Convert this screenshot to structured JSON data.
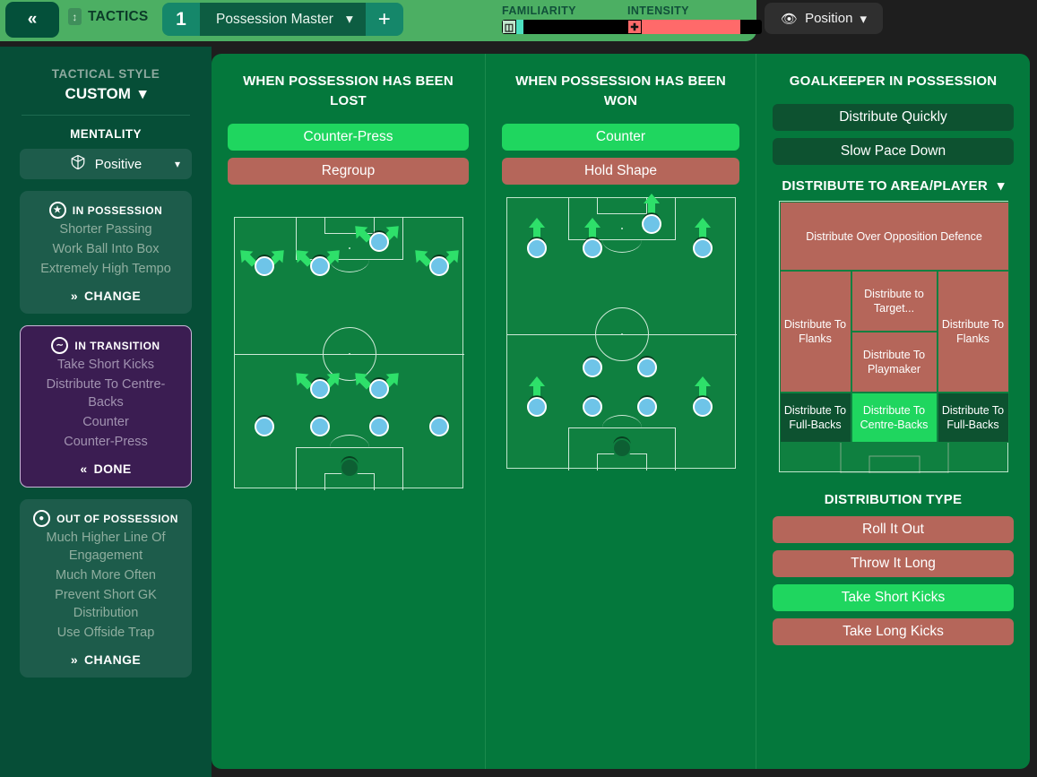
{
  "topbar": {
    "collapse_icon": "double-chevron-left",
    "tactics_label": "TACTICS",
    "tab_number": "1",
    "tab_name": "Possession Master",
    "add_label": "+",
    "familiarity_label": "FAMILIARITY",
    "intensity_label": "INTENSITY",
    "familiarity_value": 6,
    "intensity_value": 82,
    "position_button": "Position"
  },
  "sidebar": {
    "tactical_style_label": "TACTICAL STYLE",
    "tactical_style_value": "CUSTOM",
    "mentality_label": "MENTALITY",
    "mentality_value": "Positive",
    "phases": [
      {
        "title": "IN POSSESSION",
        "items": [
          "Shorter Passing",
          "Work Ball Into Box",
          "Extremely High Tempo"
        ],
        "action": "CHANGE",
        "action_icon": "double-chevron-right",
        "active": false
      },
      {
        "title": "IN TRANSITION",
        "items": [
          "Take Short Kicks",
          "Distribute To Centre-Backs",
          "Counter",
          "Counter-Press"
        ],
        "action": "DONE",
        "action_icon": "double-chevron-left",
        "active": true
      },
      {
        "title": "OUT OF POSSESSION",
        "items": [
          "Much Higher Line Of Engagement",
          "Much More Often",
          "Prevent Short GK Distribution",
          "Use Offside Trap"
        ],
        "action": "CHANGE",
        "action_icon": "double-chevron-right",
        "active": false
      }
    ]
  },
  "columns": {
    "lost": {
      "title": "WHEN POSSESSION HAS BEEN LOST",
      "options": [
        {
          "label": "Counter-Press",
          "state": "on"
        },
        {
          "label": "Regroup",
          "state": "off"
        }
      ]
    },
    "won": {
      "title": "WHEN POSSESSION HAS BEEN WON",
      "options": [
        {
          "label": "Counter",
          "state": "on"
        },
        {
          "label": "Hold Shape",
          "state": "off"
        }
      ]
    },
    "goalkeeper": {
      "title": "GOALKEEPER IN POSSESSION",
      "options": [
        {
          "label": "Distribute Quickly",
          "state": "neutral"
        },
        {
          "label": "Slow Pace Down",
          "state": "neutral"
        }
      ],
      "area_title": "DISTRIBUTE TO AREA/PLAYER",
      "area_cells": [
        {
          "label": "Distribute Over Opposition Defence",
          "state": "red"
        },
        {
          "label": "Distribute To Flanks",
          "state": "red"
        },
        {
          "label": "Distribute to Target...",
          "state": "red"
        },
        {
          "label": "Distribute To Flanks",
          "state": "red"
        },
        {
          "label": "Distribute To Playmaker",
          "state": "red"
        },
        {
          "label": "Distribute To Full-Backs",
          "state": "dark"
        },
        {
          "label": "Distribute To Centre-Backs",
          "state": "on"
        },
        {
          "label": "Distribute To Full-Backs",
          "state": "dark"
        }
      ],
      "type_title": "DISTRIBUTION TYPE",
      "types": [
        {
          "label": "Roll It Out",
          "state": "off"
        },
        {
          "label": "Throw It Long",
          "state": "off"
        },
        {
          "label": "Take Short Kicks",
          "state": "on"
        },
        {
          "label": "Take Long Kicks",
          "state": "off"
        }
      ]
    }
  },
  "colors": {
    "accent_green": "#1fd65f",
    "off_red": "#b5665a",
    "panel_green": "#04783c",
    "sidebar_green": "#064e37",
    "transition_purple": "#3b1d52",
    "player_blue": "#6ec4e8"
  }
}
